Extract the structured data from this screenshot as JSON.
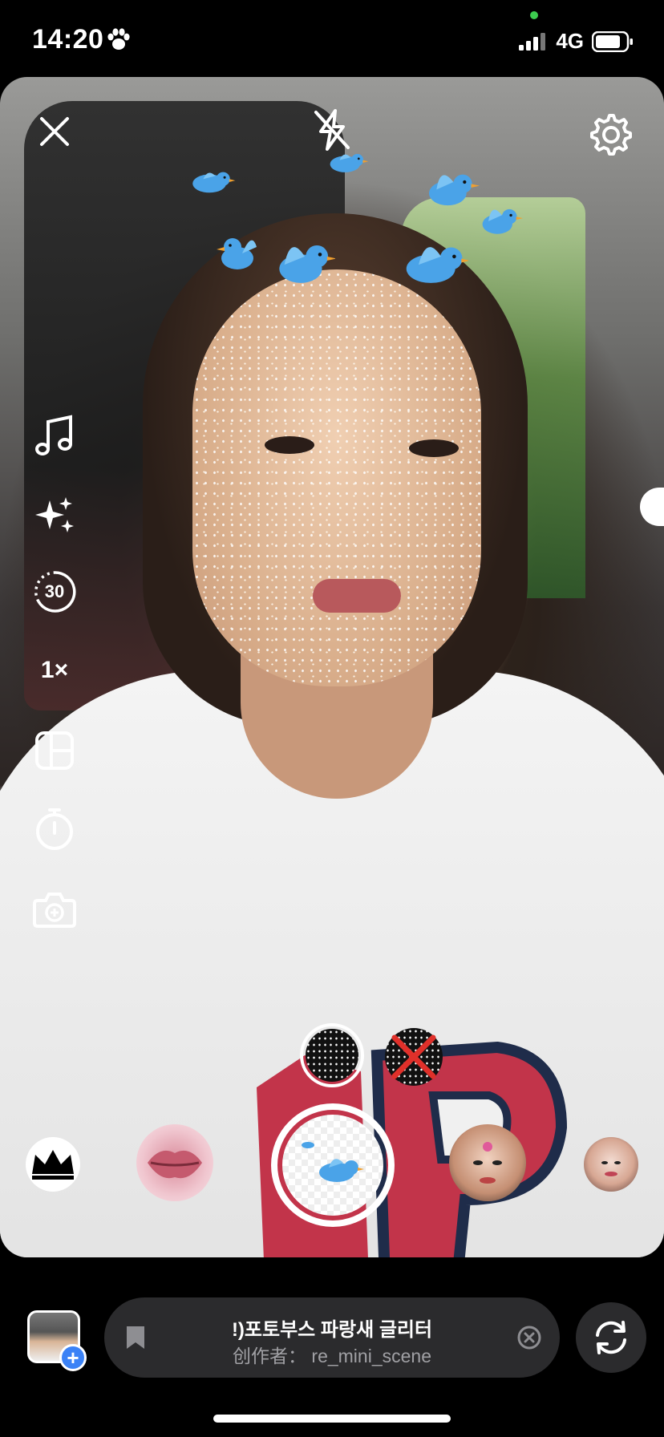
{
  "status_bar": {
    "time": "14:20",
    "network": "4G",
    "icons": [
      "paw-icon",
      "signal-icon",
      "battery-icon"
    ]
  },
  "camera": {
    "top_controls": [
      "close-icon",
      "flash-off-icon",
      "settings-gear-icon"
    ],
    "side_tools": [
      {
        "name": "music-icon"
      },
      {
        "name": "effects-sparkle-icon"
      },
      {
        "name": "duration-timer-icon",
        "label": "30"
      },
      {
        "name": "speed-control",
        "label": "1×"
      },
      {
        "name": "layout-grid-icon"
      },
      {
        "name": "countdown-timer-icon"
      },
      {
        "name": "add-camera-icon"
      }
    ]
  },
  "effects_carousel": {
    "items": [
      "crown-effect",
      "lips-effect",
      "selected-bird-glitter-effect",
      "face-paint-effect",
      "portrait-effect"
    ],
    "variants": [
      "glitter-variant",
      "no-glitter-variant"
    ]
  },
  "bottom_bar": {
    "effect_title": "!)포토부스 파랑새 글리터",
    "effect_author": "创作者： re_mini_scene",
    "gallery_plus": "+"
  },
  "colors": {
    "accent_blue": "#3b82f6",
    "pill_bg": "#2b2b2d",
    "subtitle_gray": "#a0a0a4",
    "bird_blue": "#4aa3e8"
  }
}
